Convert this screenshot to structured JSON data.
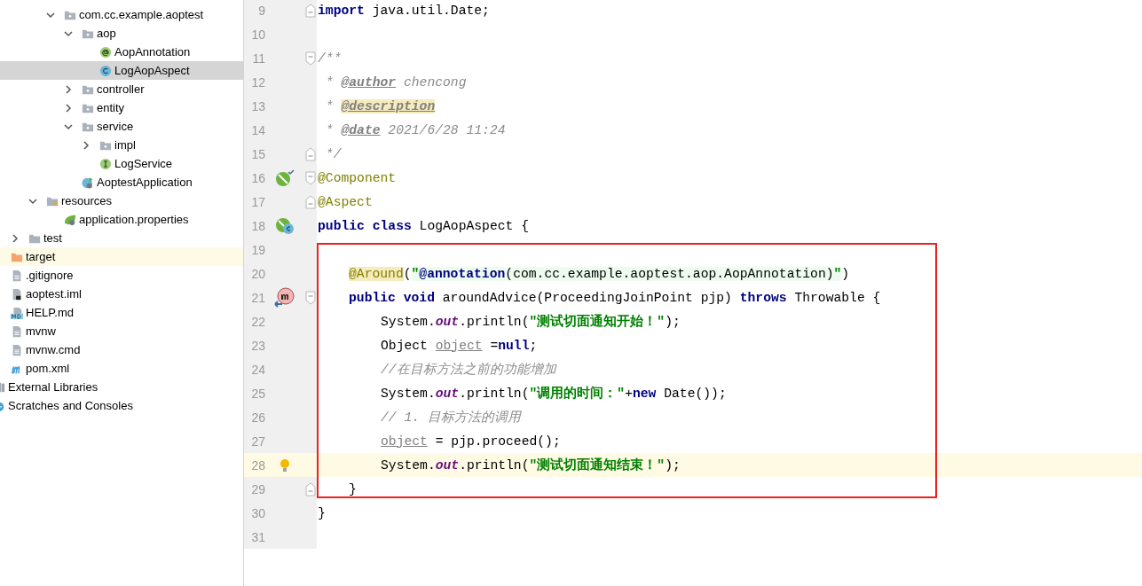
{
  "project_tree": [
    {
      "children": [
        {
          "children": [
            {
              "children": [
                {
                  "children": [
                    {
                      "label": "com.cc.example.aoptest",
                      "kind": "package",
                      "expanded": true,
                      "selected": false,
                      "children": [
                        {
                          "label": "aop",
                          "kind": "package",
                          "expanded": true,
                          "selected": false,
                          "children": [
                            {
                              "label": "AopAnnotation",
                              "kind": "annotation",
                              "selected": false
                            },
                            {
                              "label": "LogAopAspect",
                              "kind": "class",
                              "selected": true
                            }
                          ]
                        },
                        {
                          "label": "controller",
                          "kind": "package",
                          "expanded": false,
                          "selected": false
                        },
                        {
                          "label": "entity",
                          "kind": "package",
                          "expanded": false,
                          "selected": false
                        },
                        {
                          "label": "service",
                          "kind": "package",
                          "expanded": true,
                          "selected": false,
                          "children": [
                            {
                              "label": "impl",
                              "kind": "package",
                              "expanded": false,
                              "selected": false
                            },
                            {
                              "label": "LogService",
                              "kind": "interface",
                              "selected": false
                            }
                          ]
                        },
                        {
                          "label": "AoptestApplication",
                          "kind": "spring-app",
                          "selected": false
                        }
                      ]
                    }
                  ]
                },
                {
                  "label": "resources",
                  "kind": "resources",
                  "expanded": true,
                  "selected": false,
                  "children": [
                    {
                      "label": "application.properties",
                      "kind": "properties",
                      "selected": false
                    }
                  ]
                }
              ]
            },
            {
              "label": "test",
              "kind": "folder",
              "expanded": false,
              "selected": false
            }
          ]
        },
        {
          "label": "target",
          "kind": "excluded",
          "selected": false
        },
        {
          "label": ".gitignore",
          "kind": "text",
          "selected": false
        },
        {
          "label": "aoptest.iml",
          "kind": "iml",
          "selected": false
        },
        {
          "label": "HELP.md",
          "kind": "markdown",
          "selected": false
        },
        {
          "label": "mvnw",
          "kind": "text",
          "selected": false
        },
        {
          "label": "mvnw.cmd",
          "kind": "text",
          "selected": false
        },
        {
          "label": "pom.xml",
          "kind": "maven",
          "selected": false
        }
      ]
    },
    {
      "label": "External Libraries",
      "kind": "library",
      "selected": false
    },
    {
      "label": "Scratches and Consoles",
      "kind": "scratches",
      "selected": false
    }
  ],
  "editor": {
    "lines": [
      {
        "number": "9",
        "kind": "top",
        "fold": {
          "kind": "end"
        },
        "current": false,
        "boxed": false,
        "tokens": [
          {
            "kind": "keyword",
            "text": "import"
          },
          {
            "kind": "plain",
            "text": " java.util.Date;"
          }
        ]
      },
      {
        "number": "10",
        "kind": "top",
        "current": false,
        "boxed": false
      },
      {
        "number": "11",
        "kind": "top",
        "fold": {
          "kind": "start"
        },
        "current": false,
        "boxed": false,
        "tokens": [
          {
            "kind": "doc",
            "text": "/**"
          }
        ]
      },
      {
        "number": "12",
        "kind": "top",
        "current": false,
        "boxed": false,
        "tokens": [
          {
            "kind": "doc",
            "text": " * "
          },
          {
            "kind": "doctag",
            "text": "@author"
          },
          {
            "kind": "doc",
            "text": " chencong"
          }
        ]
      },
      {
        "number": "13",
        "kind": "top",
        "current": false,
        "boxed": false,
        "tokens": [
          {
            "kind": "doc",
            "text": " * "
          },
          {
            "kind": "doctag-marked",
            "text": "@description"
          }
        ]
      },
      {
        "number": "14",
        "kind": "top",
        "current": false,
        "boxed": false,
        "tokens": [
          {
            "kind": "doc",
            "text": " * "
          },
          {
            "kind": "doctag",
            "text": "@date"
          },
          {
            "kind": "doc",
            "text": " 2021/6/28 11:24"
          }
        ]
      },
      {
        "number": "15",
        "kind": "top",
        "fold": {
          "kind": "end"
        },
        "current": false,
        "boxed": false,
        "tokens": [
          {
            "kind": "doc",
            "text": " */"
          }
        ]
      },
      {
        "number": "16",
        "kind": "top",
        "fold": {
          "kind": "start"
        },
        "gutter_icon": {
          "kind": "bean"
        },
        "current": false,
        "boxed": false,
        "tokens": [
          {
            "kind": "annotation",
            "text": "@Component"
          }
        ]
      },
      {
        "number": "17",
        "kind": "top",
        "fold": {
          "kind": "end"
        },
        "current": false,
        "boxed": false,
        "tokens": [
          {
            "kind": "annotation",
            "text": "@Aspect"
          }
        ]
      },
      {
        "number": "18",
        "kind": "top",
        "gutter_icon": {
          "kind": "bean-class"
        },
        "current": false,
        "boxed": false,
        "tokens": [
          {
            "kind": "keyword",
            "text": "public class"
          },
          {
            "kind": "plain",
            "text": " LogAopAspect {"
          }
        ]
      },
      {
        "number": "19",
        "kind": "block",
        "current": false,
        "boxed": true
      },
      {
        "number": "20",
        "current": false,
        "boxed": true,
        "kind": "block",
        "tokens": [
          {
            "kind": "annotation-marked",
            "text": "@Around"
          },
          {
            "kind": "plain",
            "text": "("
          },
          {
            "kind": "string-injected",
            "text": "\""
          },
          {
            "kind": "keyword-injected",
            "text": "@annotation"
          },
          {
            "kind": "plain-injected",
            "text": "(com.cc.example.aoptest.aop.AopAnnotation)"
          },
          {
            "kind": "string-injected",
            "text": "\""
          },
          {
            "kind": "plain",
            "text": ")"
          }
        ]
      },
      {
        "number": "21",
        "fold": {
          "kind": "start"
        },
        "gutter_icon": {
          "kind": "override"
        },
        "current": false,
        "boxed": true,
        "kind": "block",
        "tokens": [
          {
            "kind": "keyword",
            "text": "public void"
          },
          {
            "kind": "plain",
            "text": " aroundAdvice(ProceedingJoinPoint pjp) "
          },
          {
            "kind": "keyword",
            "text": "throws"
          },
          {
            "kind": "plain",
            "text": " Throwable {"
          }
        ]
      },
      {
        "number": "22",
        "current": false,
        "boxed": true,
        "kind": "body",
        "tokens": [
          {
            "kind": "plain",
            "text": "System."
          },
          {
            "kind": "static",
            "text": "out"
          },
          {
            "kind": "plain",
            "text": ".println("
          },
          {
            "kind": "string",
            "text": "\"测试切面通知开始！\""
          },
          {
            "kind": "plain",
            "text": ");"
          }
        ]
      },
      {
        "number": "23",
        "current": false,
        "boxed": true,
        "kind": "body",
        "tokens": [
          {
            "kind": "plain",
            "text": "Object "
          },
          {
            "kind": "unused",
            "text": "object"
          },
          {
            "kind": "plain",
            "text": " ="
          },
          {
            "kind": "keyword",
            "text": "null"
          },
          {
            "kind": "plain",
            "text": ";"
          }
        ]
      },
      {
        "number": "24",
        "current": false,
        "boxed": true,
        "kind": "body",
        "tokens": [
          {
            "kind": "comment",
            "text": "//在目标方法之前的功能增加"
          }
        ]
      },
      {
        "number": "25",
        "current": false,
        "boxed": true,
        "kind": "body",
        "tokens": [
          {
            "kind": "plain",
            "text": "System."
          },
          {
            "kind": "static",
            "text": "out"
          },
          {
            "kind": "plain",
            "text": ".println("
          },
          {
            "kind": "string",
            "text": "\"调用的时间：\""
          },
          {
            "kind": "plain",
            "text": "+"
          },
          {
            "kind": "keyword",
            "text": "new"
          },
          {
            "kind": "plain",
            "text": " Date());"
          }
        ]
      },
      {
        "number": "26",
        "current": false,
        "boxed": true,
        "kind": "body",
        "tokens": [
          {
            "kind": "comment",
            "text": "// 1. 目标方法的调用"
          }
        ]
      },
      {
        "number": "27",
        "current": false,
        "boxed": true,
        "kind": "body",
        "tokens": [
          {
            "kind": "unused",
            "text": "object"
          },
          {
            "kind": "plain",
            "text": " = pjp.proceed();"
          }
        ]
      },
      {
        "number": "28",
        "gutter_icon": {
          "kind": "bulb"
        },
        "current": true,
        "boxed": true,
        "kind": "body",
        "tokens": [
          {
            "kind": "plain",
            "text": "System."
          },
          {
            "kind": "static",
            "text": "out"
          },
          {
            "kind": "plain",
            "text": ".println("
          },
          {
            "kind": "string",
            "text": "\"测试切面通知结束！\""
          },
          {
            "kind": "plain",
            "text": ");"
          }
        ]
      },
      {
        "number": "29",
        "fold": {
          "kind": "end"
        },
        "current": false,
        "boxed": true,
        "kind": "block",
        "tokens": [
          {
            "kind": "plain",
            "text": "}"
          }
        ]
      },
      {
        "number": "30",
        "kind": "top",
        "current": false,
        "boxed": false,
        "tokens": [
          {
            "kind": "plain",
            "text": "}"
          }
        ]
      },
      {
        "number": "31",
        "kind": "top",
        "current": false,
        "boxed": false
      }
    ]
  }
}
